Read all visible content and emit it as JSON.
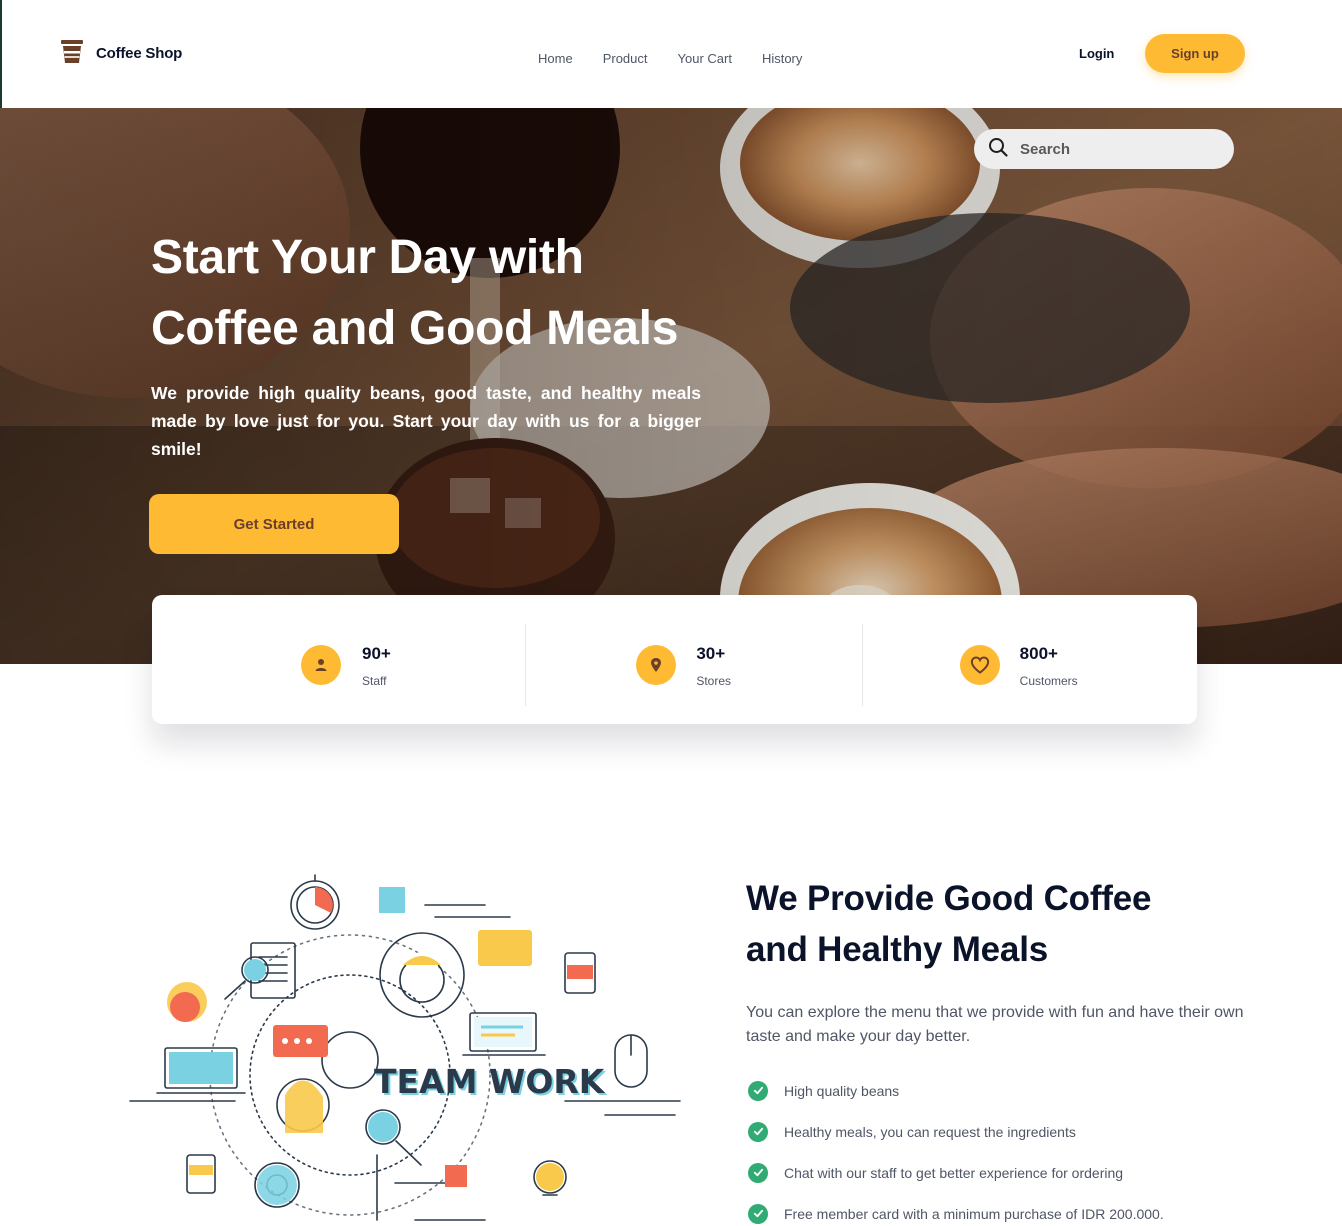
{
  "brand": {
    "name": "Coffee Shop",
    "icon": "coffee-cup-icon"
  },
  "nav": {
    "links": [
      "Home",
      "Product",
      "Your Cart",
      "History"
    ],
    "login": "Login",
    "signup": "Sign up"
  },
  "hero": {
    "search_placeholder": "Search",
    "title_line1": "Start Your Day with",
    "title_line2": "Coffee and Good Meals",
    "description": "We provide high quality beans, good taste, and healthy meals made by love just for you. Start your day with us for a bigger smile!",
    "cta": "Get Started"
  },
  "stats": [
    {
      "value": "90+",
      "label": "Staff",
      "icon": "person-icon"
    },
    {
      "value": "30+",
      "label": "Stores",
      "icon": "location-pin-icon"
    },
    {
      "value": "800+",
      "label": "Customers",
      "icon": "heart-icon"
    }
  ],
  "feature": {
    "illustration_text": "TEAM WORK",
    "title_line1": "We Provide Good Coffee",
    "title_line2": "and Healthy Meals",
    "description": "You can explore the menu that we provide with fun and have their own taste and make your day better.",
    "points": [
      "High quality beans",
      "Healthy meals, you can request the ingredients",
      "Chat with our staff to get better experience for ordering",
      "Free member card with a minimum purchase of IDR 200.000."
    ]
  },
  "colors": {
    "accent": "#ffba33",
    "brown": "#6a4029",
    "check_green": "#2fab73",
    "text_dark": "#0b132a",
    "text_muted": "#4f5665"
  }
}
